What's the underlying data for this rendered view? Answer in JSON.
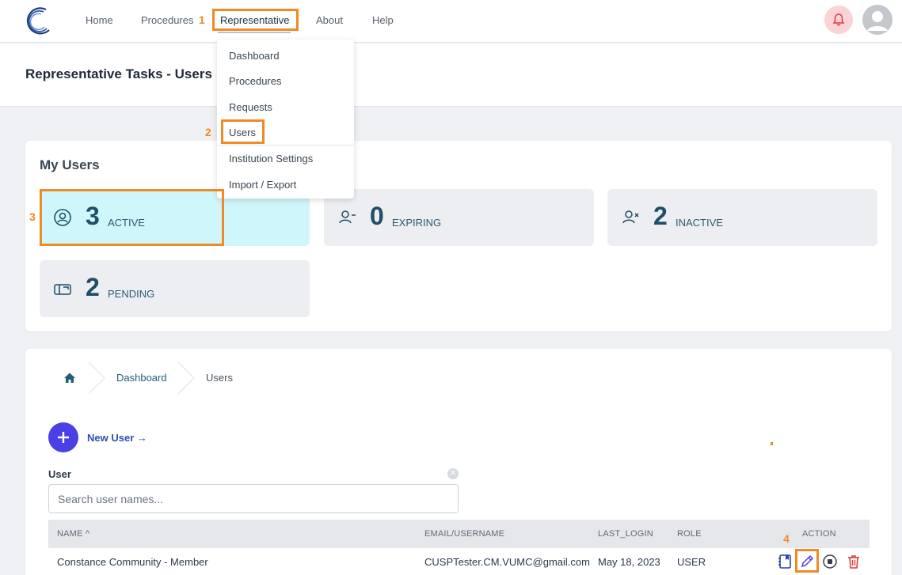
{
  "nav": {
    "home": "Home",
    "procedures": "Procedures",
    "representative": "Representative",
    "about": "About",
    "help": "Help"
  },
  "dropdown": {
    "items": [
      "Dashboard",
      "Procedures",
      "Requests",
      "Users",
      "Institution Settings",
      "Import / Export"
    ]
  },
  "page": {
    "title": "Representative Tasks - Users"
  },
  "my_users": {
    "title": "My Users",
    "stats": [
      {
        "count": "3",
        "label": "ACTIVE",
        "icon": "user-circle-icon"
      },
      {
        "count": "0",
        "label": "EXPIRING",
        "icon": "user-minus-icon"
      },
      {
        "count": "2",
        "label": "INACTIVE",
        "icon": "user-x-icon"
      },
      {
        "count": "2",
        "label": "PENDING",
        "icon": "mailbox-icon"
      }
    ]
  },
  "breadcrumb": {
    "home_icon": "home-icon",
    "items": [
      "Dashboard",
      "Users"
    ]
  },
  "new_user": {
    "label": "New User →"
  },
  "search": {
    "label": "User",
    "placeholder": "Search user names...",
    "value": ""
  },
  "table": {
    "headers": [
      "NAME ^",
      "EMAIL/USERNAME",
      "LAST_LOGIN",
      "ROLE",
      "ACTION"
    ],
    "rows": [
      {
        "name": "Constance Community - Member",
        "email": "CUSPTester.CM.VUMC@gmail.com",
        "last_login": "May 18, 2023",
        "role": "USER",
        "actions": [
          "notebook-icon",
          "pencil-icon",
          "stop-circle-icon",
          "trash-icon"
        ]
      }
    ]
  },
  "annotations": [
    "1",
    "2",
    "3",
    "4"
  ],
  "colors": {
    "accent": "#f08a24",
    "active_card": "#cff6fa",
    "primary_button": "#4b3fe6",
    "stat_number": "#1f4e66",
    "bell_bg": "#fbd3d6",
    "delete": "#d9403a"
  }
}
